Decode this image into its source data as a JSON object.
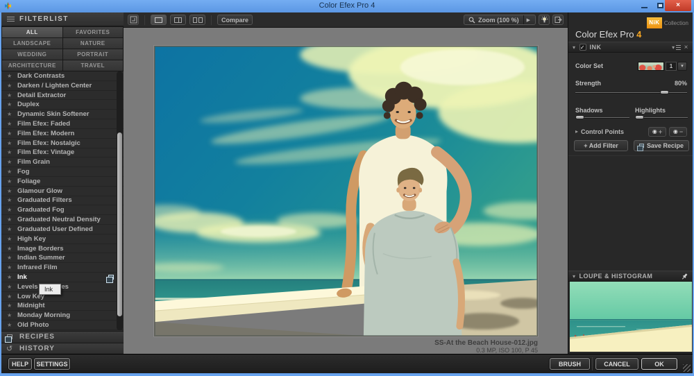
{
  "window": {
    "title": "Color Efex Pro 4"
  },
  "toolbar": {
    "compare_label": "Compare",
    "zoom_label": "Zoom (100 %)"
  },
  "sidebar": {
    "header": "FILTERLIST",
    "categories": [
      "ALL",
      "FAVORITES",
      "LANDSCAPE",
      "NATURE",
      "WEDDING",
      "PORTRAIT",
      "ARCHITECTURE",
      "TRAVEL"
    ],
    "filters": [
      "Dark Contrasts",
      "Darken / Lighten Center",
      "Detail Extractor",
      "Duplex",
      "Dynamic Skin Softener",
      "Film Efex: Faded",
      "Film Efex: Modern",
      "Film Efex: Nostalgic",
      "Film Efex: Vintage",
      "Film Grain",
      "Fog",
      "Foliage",
      "Glamour Glow",
      "Graduated Filters",
      "Graduated Fog",
      "Graduated Neutral Density",
      "Graduated User Defined",
      "High Key",
      "Image Borders",
      "Indian Summer",
      "Infrared Film",
      "Ink",
      "Levels & Curves",
      "Low Key",
      "Midnight",
      "Monday Morning",
      "Old Photo"
    ],
    "selected_filter": "Ink",
    "tooltip": "Ink",
    "recipes_header": "RECIPES",
    "history_header": "HISTORY"
  },
  "panel": {
    "logo": "NiK",
    "collection": "Collection",
    "title": "Color Efex Pro",
    "version": "4",
    "module_name": "INK",
    "color_set_label": "Color Set",
    "color_set_value": "1",
    "strength_label": "Strength",
    "strength_value": "80%",
    "shadows_label": "Shadows",
    "highlights_label": "Highlights",
    "control_points_label": "Control Points",
    "add_filter_label": "+ Add Filter",
    "save_recipe_label": "Save Recipe",
    "loupe_header": "LOUPE & HISTOGRAM"
  },
  "status": {
    "filename": "SS-At the Beach House-012.jpg",
    "fileinfo": "0.3 MP, ISO 100, P 45"
  },
  "footer": {
    "help": "HELP",
    "settings": "SETTINGS",
    "brush": "BRUSH",
    "cancel": "CANCEL",
    "ok": "OK"
  },
  "icons": {
    "star": "★",
    "check": "✓",
    "close": "×",
    "caret_down": "▾",
    "caret_right": "▸",
    "arrow_right": "▶",
    "plus": "+",
    "minus": "−",
    "dot": "◉",
    "history": "↺"
  },
  "colors": {
    "accent_orange": "#f5a623",
    "titlebar_blue": "#5f9de8",
    "canvas_grey": "#7b7b7b",
    "close_red": "#c03a27"
  }
}
